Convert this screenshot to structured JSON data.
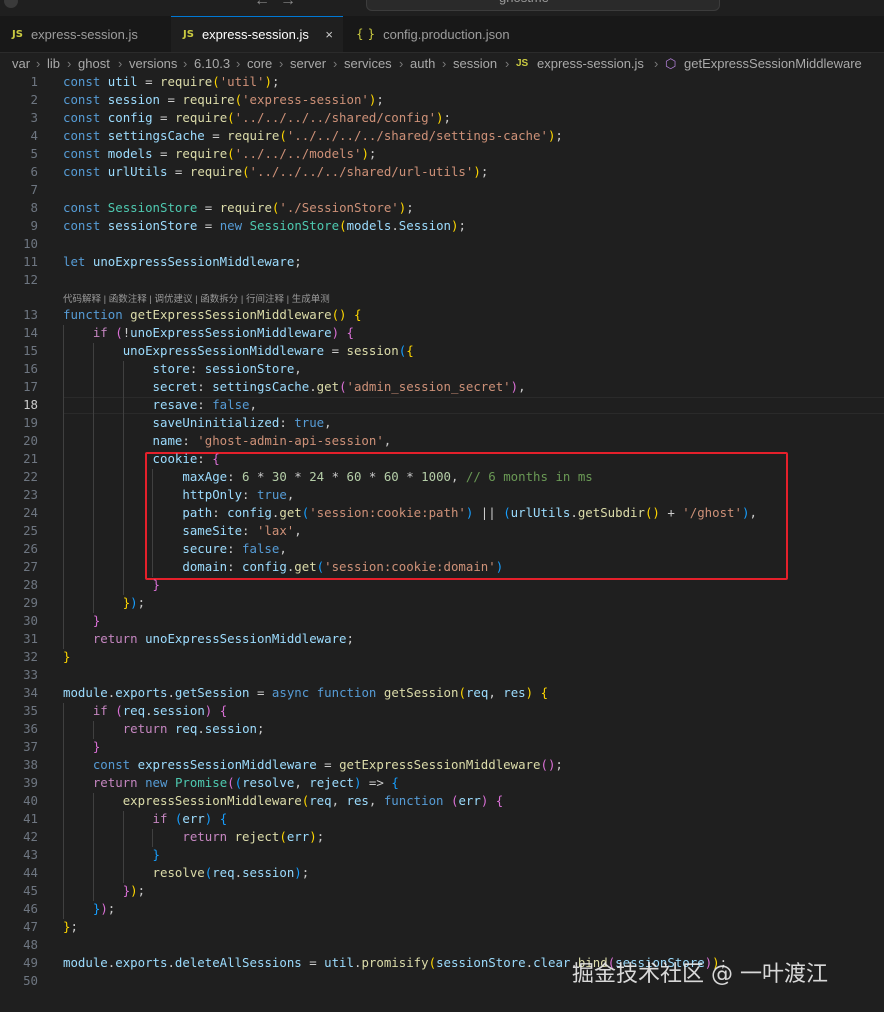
{
  "topbar": {
    "search_text": "ghostme"
  },
  "tabs": [
    {
      "icon": "JS",
      "label": "express-session.js"
    },
    {
      "icon": "JS",
      "label": "express-session.js",
      "close": "×"
    },
    {
      "icon": "{ }",
      "label": "config.production.json"
    }
  ],
  "breadcrumb": [
    "var",
    "lib",
    "ghost",
    "versions",
    "6.10.3",
    "core",
    "server",
    "services",
    "auth",
    "session",
    "JS",
    "express-session.js",
    "getExpressSessionMiddleware"
  ],
  "codelens": "代码解释 | 函数注释 | 调优建议 | 函数拆分 | 行间注释 | 生成单测",
  "current_line": 18,
  "lines": [
    [
      1,
      "const util = require('util');"
    ],
    [
      2,
      "const session = require('express-session');"
    ],
    [
      3,
      "const config = require('../../../../shared/config');"
    ],
    [
      4,
      "const settingsCache = require('../../../../shared/settings-cache');"
    ],
    [
      5,
      "const models = require('../../../models');"
    ],
    [
      6,
      "const urlUtils = require('../../../../shared/url-utils');"
    ],
    [
      7,
      ""
    ],
    [
      8,
      "const SessionStore = require('./SessionStore');"
    ],
    [
      9,
      "const sessionStore = new SessionStore(models.Session);"
    ],
    [
      10,
      ""
    ],
    [
      11,
      "let unoExpressSessionMiddleware;"
    ],
    [
      12,
      ""
    ],
    [
      13,
      "function getExpressSessionMiddleware() {"
    ],
    [
      14,
      "    if (!unoExpressSessionMiddleware) {"
    ],
    [
      15,
      "        unoExpressSessionMiddleware = session({"
    ],
    [
      16,
      "            store: sessionStore,"
    ],
    [
      17,
      "            secret: settingsCache.get('admin_session_secret'),"
    ],
    [
      18,
      "            resave: false,"
    ],
    [
      19,
      "            saveUninitialized: true,"
    ],
    [
      20,
      "            name: 'ghost-admin-api-session',"
    ],
    [
      21,
      "            cookie: {"
    ],
    [
      22,
      "                maxAge: 6 * 30 * 24 * 60 * 60 * 1000, // 6 months in ms"
    ],
    [
      23,
      "                httpOnly: true,"
    ],
    [
      24,
      "                path: config.get('session:cookie:path') || (urlUtils.getSubdir() + '/ghost'),"
    ],
    [
      25,
      "                sameSite: 'lax',"
    ],
    [
      26,
      "                secure: false,"
    ],
    [
      27,
      "                domain: config.get('session:cookie:domain')"
    ],
    [
      28,
      "            }"
    ],
    [
      29,
      "        });"
    ],
    [
      30,
      "    }"
    ],
    [
      31,
      "    return unoExpressSessionMiddleware;"
    ],
    [
      32,
      "}"
    ],
    [
      33,
      ""
    ],
    [
      34,
      "module.exports.getSession = async function getSession(req, res) {"
    ],
    [
      35,
      "    if (req.session) {"
    ],
    [
      36,
      "        return req.session;"
    ],
    [
      37,
      "    }"
    ],
    [
      38,
      "    const expressSessionMiddleware = getExpressSessionMiddleware();"
    ],
    [
      39,
      "    return new Promise((resolve, reject) => {"
    ],
    [
      40,
      "        expressSessionMiddleware(req, res, function (err) {"
    ],
    [
      41,
      "            if (err) {"
    ],
    [
      42,
      "                return reject(err);"
    ],
    [
      43,
      "            }"
    ],
    [
      44,
      "            resolve(req.session);"
    ],
    [
      45,
      "        });"
    ],
    [
      46,
      "    });"
    ],
    [
      47,
      "};"
    ],
    [
      48,
      ""
    ],
    [
      49,
      "module.exports.deleteAllSessions = util.promisify(sessionStore.clear.bind(sessionStore));"
    ],
    [
      50,
      ""
    ]
  ],
  "watermark": "掘金技术社区 @ 一叶渡江",
  "colors": {
    "keyword": "#569cd6",
    "control": "#c586c0",
    "variable": "#9cdcfe",
    "function": "#dcdcaa",
    "string": "#ce9178",
    "class": "#4ec9b0",
    "number": "#b5cea8",
    "comment": "#6a9955",
    "highlight_box": "#e5202b"
  }
}
